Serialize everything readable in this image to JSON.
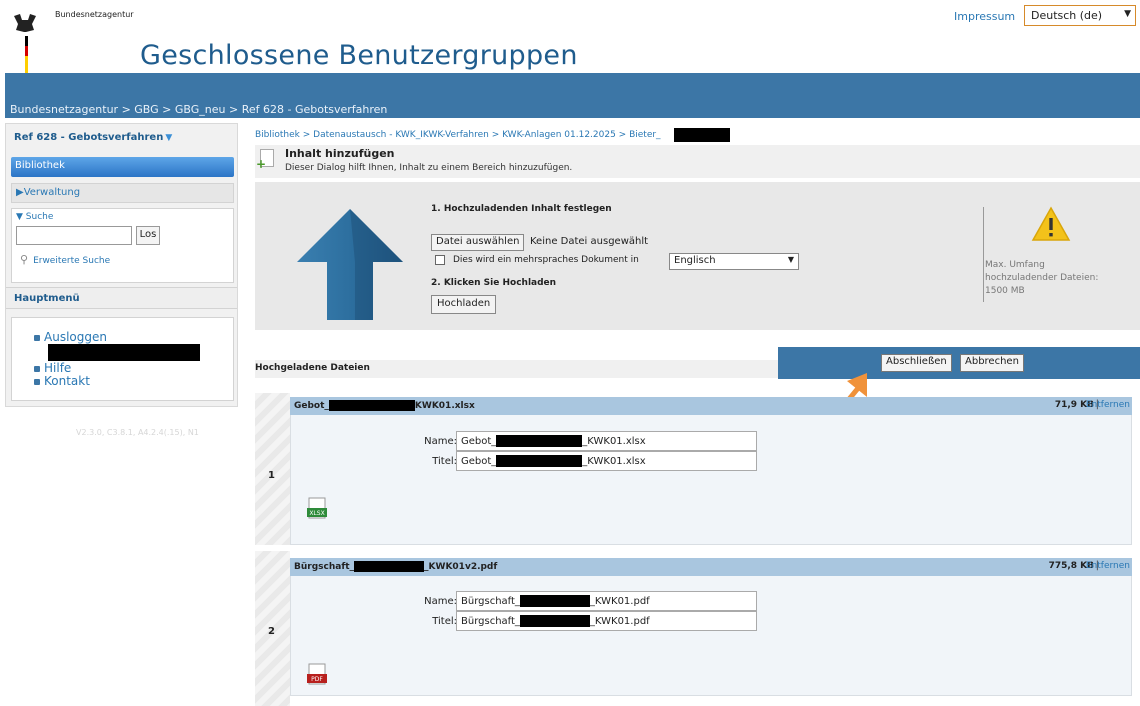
{
  "header": {
    "agency": "Bundesnetzagentur",
    "title": "Geschlossene Benutzergruppen",
    "impressum": "Impressum",
    "language": "Deutsch (de)",
    "breadcrumb": "Bundesnetzagentur > GBG > GBG_neu > Ref 628 - Gebotsverfahren"
  },
  "sidebar": {
    "title": "Ref 628 - Gebotsverfahren",
    "active": "Bibliothek",
    "verwaltung": "Verwaltung",
    "search_label": "Suche",
    "search_button": "Los",
    "advanced_search": "Erweiterte Suche",
    "hauptmenu": "Hauptmenü",
    "menu": [
      "Ausloggen",
      "Hilfe",
      "Kontakt"
    ],
    "version": "V2.3.0, C3.8.1, A4.2.4(.15), N1"
  },
  "main": {
    "breadcrumb": "Bibliothek > Datenaustausch - KWK_IKWK-Verfahren > KWK-Anlagen 01.12.2025 > Bieter_",
    "add_title": "Inhalt hinzufügen",
    "add_subtitle": "Dieser Dialog hilft Ihnen, Inhalt zu einem Bereich hinzuzufügen.",
    "step1": "1. Hochzuladenden Inhalt festlegen",
    "file_button": "Datei auswählen",
    "no_file": "Keine Datei ausgewählt",
    "multilingual": "Dies wird ein mehrspraches Dokument in",
    "doc_language": "Englisch",
    "step2": "2. Klicken Sie Hochladen",
    "upload_button": "Hochladen",
    "max_info": [
      "Max. Umfang",
      "hochzuladender Dateien:",
      "1500 MB"
    ],
    "uploaded_label": "Hochgeladene Dateien",
    "finish_button": "Abschließen",
    "cancel_button": "Abbrechen"
  },
  "files": [
    {
      "num": "1",
      "name_prefix": "Gebot_",
      "name_suffix": "KWK01.xlsx",
      "size": "71,9 KB",
      "remove": "Entfernen",
      "name_label": "Name:",
      "title_label": "Titel:",
      "field_prefix": "Gebot_",
      "field_suffix": "_KWK01.xlsx",
      "icon": "xlsx-file-icon"
    },
    {
      "num": "2",
      "name_prefix": "Bürgschaft_",
      "name_suffix": "_KWK01v2.pdf",
      "size": "775,8 KB",
      "remove": "Entfernen",
      "name_label": "Name:",
      "title_label": "Titel:",
      "field_prefix": "Bürgschaft_",
      "field_suffix": "_KWK01.pdf",
      "icon": "pdf-file-icon"
    }
  ]
}
